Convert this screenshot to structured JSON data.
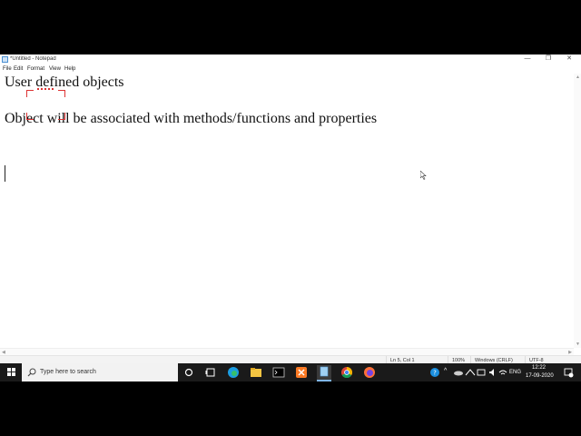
{
  "window": {
    "title": "*Untitled - Notepad",
    "minimize_glyph": "—",
    "restore_glyph": "❐",
    "close_glyph": "✕"
  },
  "menu": [
    "File",
    "Edit",
    "Format",
    "View",
    "Help"
  ],
  "editor": {
    "lines": [
      "User defined objects",
      "Object will be associated with methods/functions and properties"
    ]
  },
  "status": {
    "position": "Ln 5, Col 1",
    "zoom": "100%",
    "line_ending": "Windows (CRLF)",
    "encoding": "UTF-8"
  },
  "taskbar": {
    "search_placeholder": "Type here to search",
    "language": "ENG",
    "time": "12:22",
    "date": "17-09-2020"
  },
  "colors": {
    "taskbar": "#1a1a1a",
    "accent_blue": "#0078d7",
    "highlight_red": "#dd3333"
  }
}
